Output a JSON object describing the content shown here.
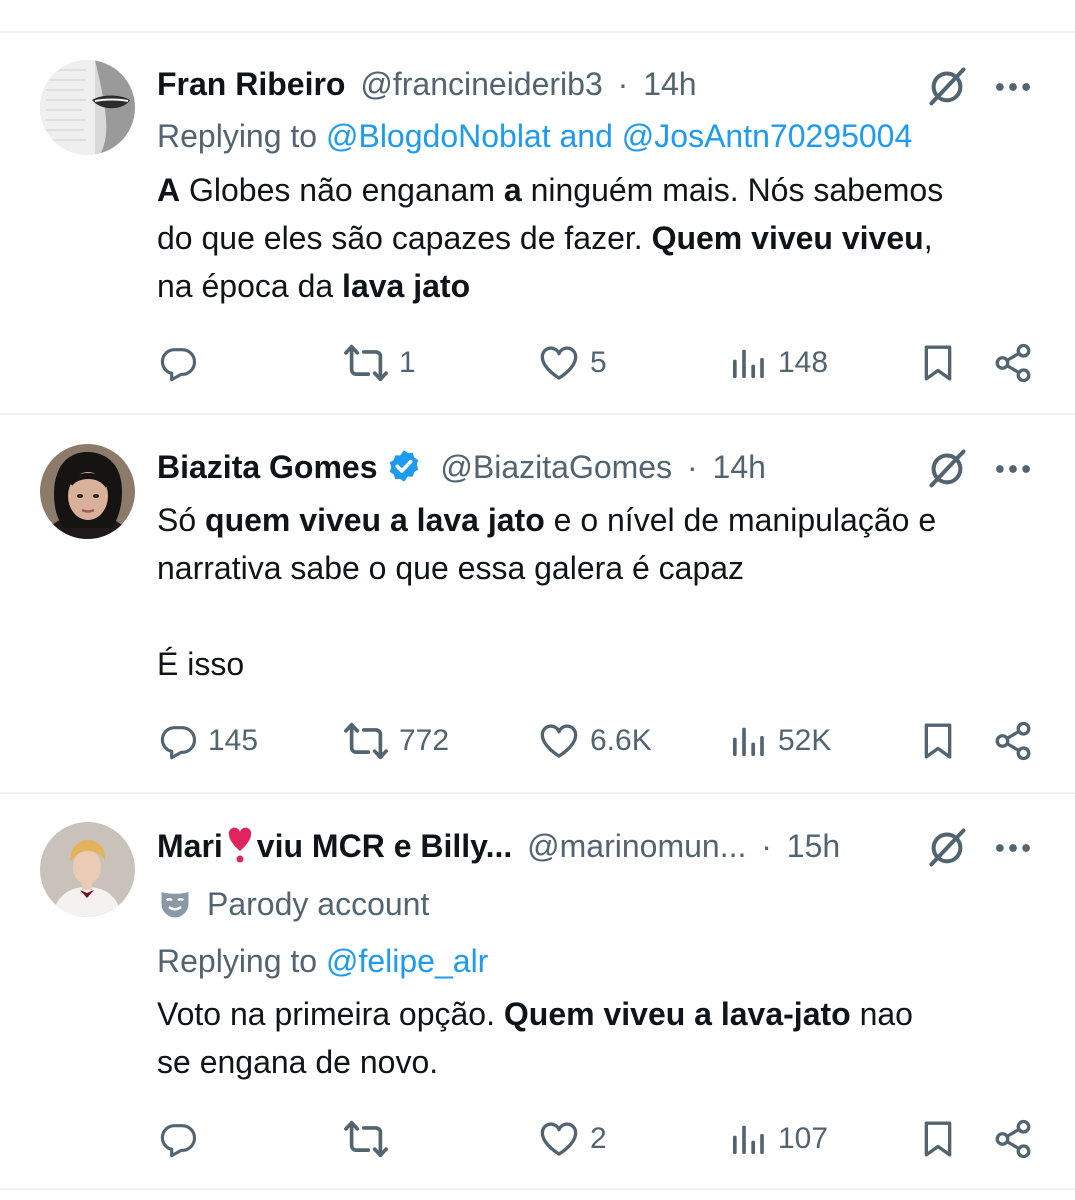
{
  "tweets": [
    {
      "name": "Fran Ribeiro",
      "handle": "@francineiderib3",
      "sep": "·",
      "time": "14h",
      "replying_prefix": "Replying to",
      "replying_user1": "@BlogdoNoblat",
      "replying_and": "and",
      "replying_user2": "@JosAntn70295004",
      "body": {
        "l1_a": "A",
        "l1_b": " Globes não enganam ",
        "l1_c": "a",
        "l1_d": " ninguém mais. Nós sabemos",
        "l2_a": "do que eles são capazes de fazer. ",
        "l2_b": "Quem viveu viveu",
        "l2_c": ",",
        "l3_a": "na época da ",
        "l3_b": "lava jato"
      },
      "stats": {
        "replies": "",
        "reposts": "1",
        "likes": "5",
        "views": "148"
      }
    },
    {
      "name": "Biazita Gomes",
      "handle": "@BiazitaGomes",
      "sep": "·",
      "time": "14h",
      "body": {
        "l1_a": "Só ",
        "l1_b": "quem viveu a lava jato",
        "l1_c": " e o nível de manipulação e",
        "l2": "narrativa sabe o que essa galera é capaz",
        "l3": "É isso"
      },
      "stats": {
        "replies": "145",
        "reposts": "772",
        "likes": "6.6K",
        "views": "52K"
      }
    },
    {
      "name": "Mari",
      "name_rest": "viu MCR e Billy...",
      "handle": "@marinomun...",
      "sep": "·",
      "time": "15h",
      "parody_label": "Parody account",
      "replying_prefix": "Replying to",
      "replying_user1": "@felipe_alr",
      "body": {
        "l1_a": "Voto na primeira opção.  ",
        "l1_b": "Quem viveu a lava-jato",
        "l1_c": "  nao",
        "l2": "se engana de novo."
      },
      "stats": {
        "replies": "",
        "reposts": "",
        "likes": "2",
        "views": "107"
      }
    }
  ],
  "colors": {
    "text": "#0f1419",
    "muted": "#536471",
    "link": "#1d9bf0",
    "divider": "#eff3f4",
    "heart_red": "#e0245e"
  },
  "icons": [
    "reply-icon",
    "repost-icon",
    "like-icon",
    "views-icon",
    "bookmark-icon",
    "share-icon",
    "grok-icon",
    "more-icon",
    "verified-icon",
    "parody-mask-icon"
  ]
}
